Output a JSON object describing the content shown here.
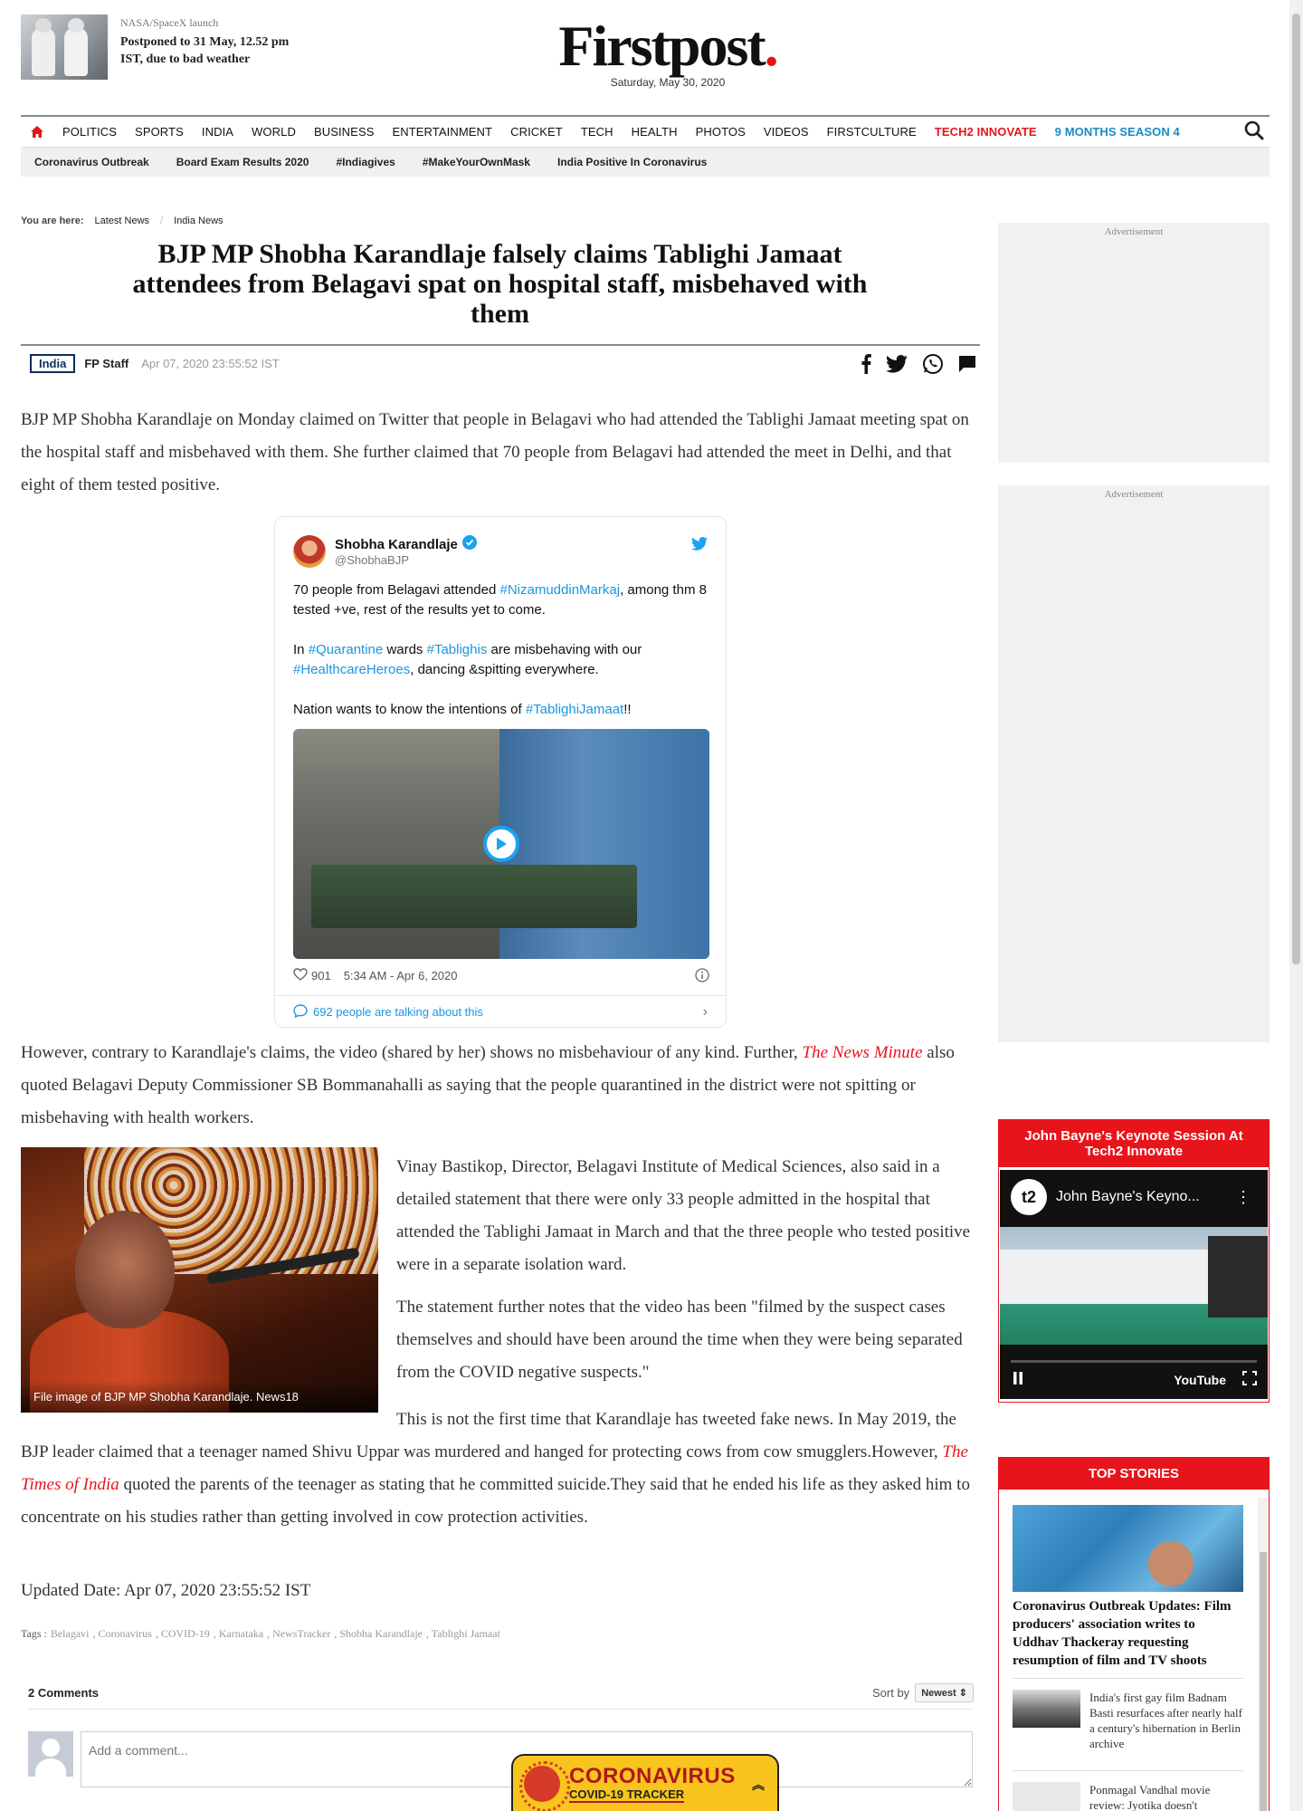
{
  "promo": {
    "kicker": "NASA/SpaceX launch",
    "headline": "Postponed to 31 May, 12.52 pm IST, due to bad weather"
  },
  "logo": {
    "name": "Firstpost",
    "dot": ".",
    "date": "Saturday, May 30, 2020"
  },
  "nav": {
    "items": [
      "POLITICS",
      "SPORTS",
      "INDIA",
      "WORLD",
      "BUSINESS",
      "ENTERTAINMENT",
      "CRICKET",
      "TECH",
      "HEALTH",
      "PHOTOS",
      "VIDEOS",
      "FIRSTCULTURE"
    ],
    "highlight_red": "TECH2 INNOVATE",
    "highlight_blue": "9 MONTHS SEASON 4"
  },
  "subnav": [
    "Coronavirus Outbreak",
    "Board Exam Results 2020",
    "#Indiagives",
    "#MakeYourOwnMask",
    "India Positive In Coronavirus"
  ],
  "breadcrumb": {
    "label": "You are here:",
    "items": [
      "Latest News",
      "India News"
    ]
  },
  "article": {
    "title": "BJP MP Shobha Karandlaje falsely claims Tablighi Jamaat attendees from Belagavi spat on hospital staff, misbehaved with them",
    "category": "India",
    "author": "FP Staff",
    "date": "Apr 07, 2020 23:55:52 IST",
    "para1": "BJP MP Shobha Karandlaje on Monday claimed on Twitter that people in Belagavi who had attended the Tablighi Jamaat meeting spat on the hospital staff and misbehaved with them. She further claimed that 70 people from Belagavi had attended the meet in Delhi, and that eight of them tested positive.",
    "para2_a": "However, contrary to Karandlaje's claims, the video (shared by her) shows no misbehaviour of any kind. Further, ",
    "para2_link": "The News Minute",
    "para2_b": " also quoted Belagavi Deputy Commissioner SB Bommanahalli as saying that the people quarantined in the district were not spitting or misbehaving with health workers.",
    "para3": "Vinay Bastikop, Director, Belagavi Institute of Medical Sciences, also said in a detailed statement that there were only 33 people admitted in the hospital that attended the Tablighi Jamaat in March and that the three people who tested positive were in a separate isolation ward.",
    "para4": "The statement further notes that the video has been \"filmed by the suspect cases themselves and should have been around the time when they were being separated from the COVID negative suspects.\"",
    "para5_a": "This is not the first time that Karandlaje has tweeted fake news. In May 2019, the BJP leader claimed that a teenager named Shivu Uppar was murdered and hanged for protecting cows from cow smugglers.However, ",
    "para5_link": "The Times of India",
    "para5_b": " quoted the parents of the teenager as stating that he committed suicide.They said that he ended his life as they asked him to concentrate on his studies rather than getting involved in cow protection activities.",
    "image_caption": "File image of BJP MP Shobha Karandlaje. News18",
    "updated": "Updated Date: Apr 07, 2020 23:55:52 IST",
    "tags_label": "Tags :",
    "tags": [
      "Belagavi",
      ", Coronavirus",
      ", COVID-19",
      ", Karnataka",
      ", NewsTracker",
      ", Shobha Karandlaje",
      ", Tablighi Jamaat"
    ]
  },
  "tweet": {
    "name": "Shobha Karandlaje",
    "handle": "@ShobhaBJP",
    "line1_a": "70 people from Belagavi attended ",
    "line1_tag": "#NizamuddinMarkaj",
    "line1_b": ", among thm 8 tested +ve, rest of the results yet to come.",
    "line2_a": "In ",
    "line2_tag1": "#Quarantine",
    "line2_b": " wards ",
    "line2_tag2": "#Tablighis",
    "line2_c": " are misbehaving with our ",
    "line2_tag3": "#HealthcareHeroes",
    "line2_d": ", dancing &spitting everywhere.",
    "line3_a": "Nation wants to know the intentions of ",
    "line3_tag": "#TablighiJamaat",
    "line3_b": "!!",
    "likes": "901",
    "time": "5:34 AM - Apr 6, 2020",
    "talking": "692 people are talking about this"
  },
  "comments": {
    "count": "2 Comments",
    "sort_label": "Sort by",
    "sort_value": "Newest",
    "placeholder": "Add a comment..."
  },
  "sidebar": {
    "ad_label": "Advertisement",
    "video_title": "John Bayne's Keynote Session At Tech2 Innovate",
    "video_name": "John Bayne's Keyno...",
    "video_brand": "YouTube",
    "top_stories": "TOP STORIES",
    "story_main": "Coronavirus Outbreak Updates: Film producers' association writes to Uddhav Thackeray requesting resumption of film and TV shoots",
    "story2": "India's first gay film Badnam Basti resurfaces after nearly half a century's hibernation in Berlin archive",
    "story3": "Ponmagal Vandhal movie review: Jyotika doesn't"
  },
  "tracker": {
    "title": "CORONAVIRUS",
    "sub": "COVID-19 TRACKER"
  },
  "colors": {
    "brand_red": "#e8141b",
    "link_blue": "#1b95e0",
    "nav_blue": "#1a8bc7",
    "tracker_yellow": "#f7c51e"
  }
}
